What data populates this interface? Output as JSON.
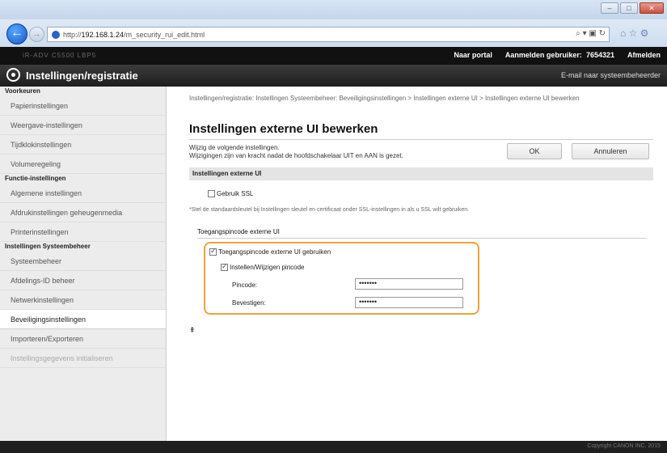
{
  "browser": {
    "url_prefix": "http://",
    "url_host": "192.168.1.24",
    "url_path": "/m_security_rui_edit.html",
    "url_tools": "⌕ ▾ ▣ ↻",
    "tabs_icons": "⌂ ☆ ⚙",
    "window_buttons": [
      "–",
      "□",
      "✕"
    ]
  },
  "topbar": {
    "device_name": "iR-ADV  C5500  LBP5",
    "portal_link": "Naar portal",
    "login_user_label": "Aanmelden gebruiker:",
    "login_user_value": "7654321",
    "logout_link": "Afmelden"
  },
  "header": {
    "title": "Instellingen/registratie",
    "mail_admin": "E-mail naar systeembeheerder"
  },
  "sidebar": {
    "sections": [
      {
        "title": "Voorkeuren",
        "items": [
          "Papierinstellingen",
          "Weergave-instellingen",
          "Tijdklokinstellingen",
          "Volumeregeling"
        ]
      },
      {
        "title": "Functie-instellingen",
        "items": [
          "Algemene instellingen",
          "Afdrukinstellingen geheugenmedia",
          "Printerinstellingen"
        ]
      },
      {
        "title": "Instellingen Systeembeheer",
        "items": [
          "Systeembeheer",
          "Afdelings-ID beheer",
          "Netwerkinstellingen",
          "Beveiligingsinstellingen",
          "Importeren/Exporteren",
          "Instellingsgegevens initialiseren"
        ]
      }
    ]
  },
  "main": {
    "breadcrumb": "Instellingen/registratie: Instellingen Systeembeheer: Beveiligingsinstellingen > Instellingen externe UI > Instellingen externe UI bewerken",
    "title": "Instellingen externe UI bewerken",
    "instruction_1": "Wijzig de volgende instellingen.",
    "instruction_2": "Wijzigingen zijn van kracht nadat de hoofdschakelaar UIT en AAN is gezet.",
    "ok_button": "OK",
    "cancel_button": "Annuleren",
    "section_title": "Instellingen externe UI",
    "use_ssl_label": "Gebruik SSL",
    "use_ssl_checked": false,
    "ssl_note": "*Stel de standaardsleutel bij Instellingen sleutel en certificaat onder SSL-instellingen in als u SSL wilt gebruiken.",
    "pin_subhead": "Toegangspincode externe UI",
    "use_pin_label": "Toegangspincode externe UI gebruiken",
    "use_pin_checked": true,
    "set_change_pin_label": "Instellen/Wijzigen pincode",
    "set_change_pin_checked": true,
    "pin_label": "Pincode:",
    "pin_value": "•••••••",
    "confirm_label": "Bevestigen:",
    "confirm_value": "•••••••",
    "to_top": "⇞"
  },
  "footer": {
    "copyright": "Copyright CANON INC. 2015"
  },
  "colors": {
    "highlight": "#f0a23b",
    "header_bg": "#2a2a2a",
    "sidebar_bg": "#ececec"
  }
}
